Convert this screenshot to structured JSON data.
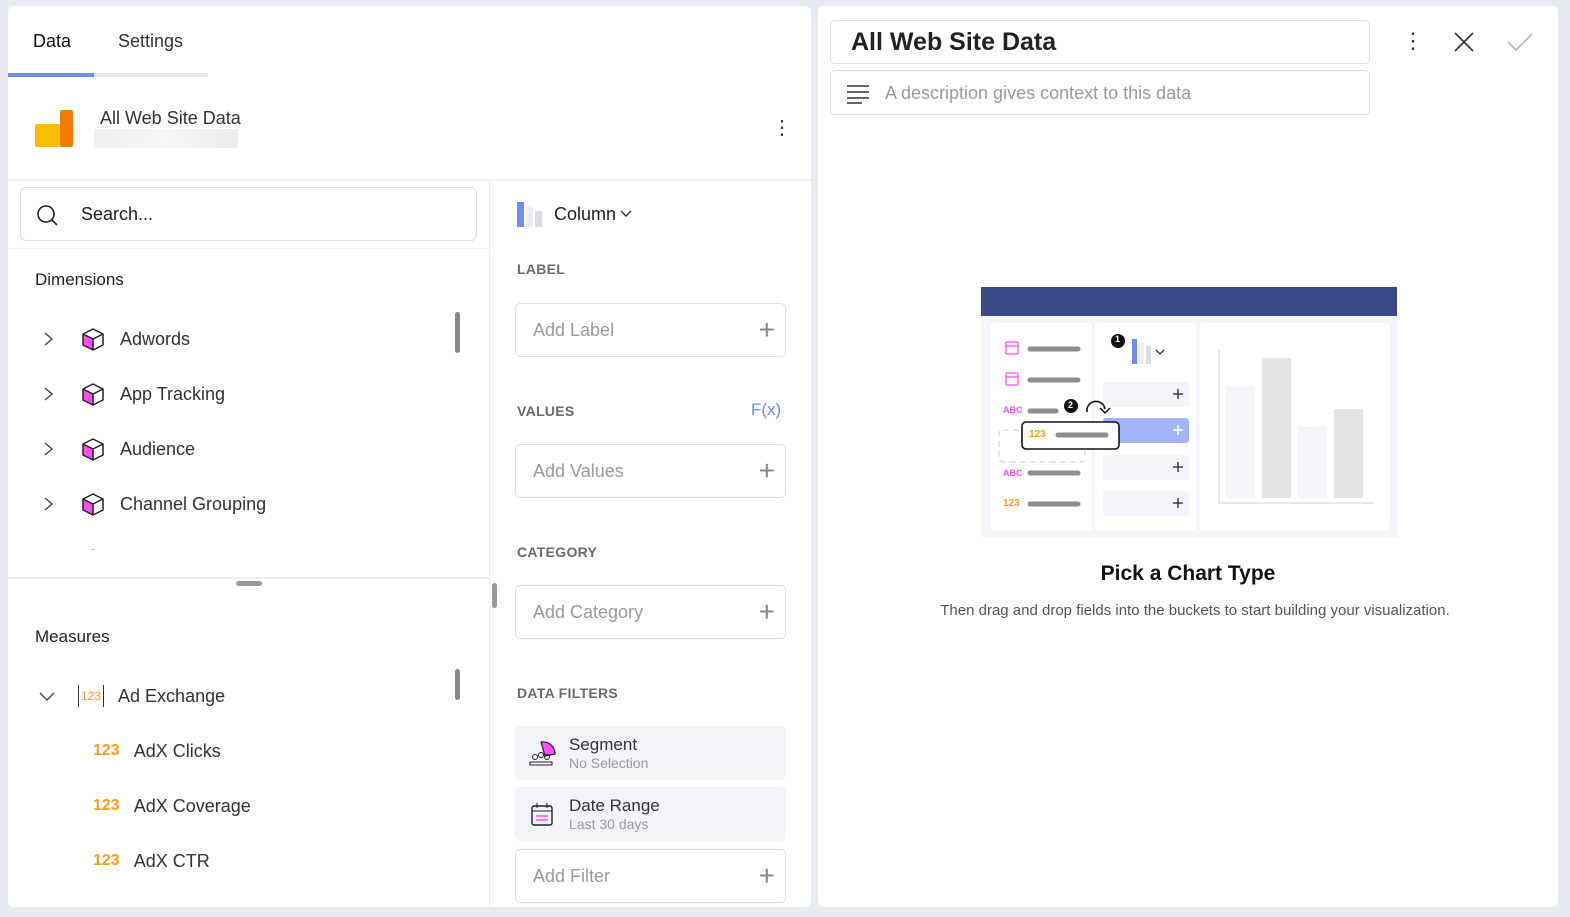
{
  "tabs": [
    {
      "label": "Data",
      "active": true
    },
    {
      "label": "Settings",
      "active": false
    }
  ],
  "source": {
    "title": "All Web Site Data"
  },
  "search": {
    "placeholder": "Search..."
  },
  "dimensions": {
    "title": "Dimensions",
    "items": [
      "Adwords",
      "App Tracking",
      "Audience",
      "Channel Grouping"
    ]
  },
  "measures": {
    "title": "Measures",
    "group": "Ad Exchange",
    "group_icon": "123",
    "items": [
      "AdX Clicks",
      "AdX Coverage",
      "AdX CTR"
    ]
  },
  "chart_type": {
    "label": "Column"
  },
  "buckets": {
    "label": {
      "caption": "LABEL",
      "placeholder": "Add Label"
    },
    "values": {
      "caption": "VALUES",
      "placeholder": "Add Values",
      "fx": "F(x)"
    },
    "category": {
      "caption": "CATEGORY",
      "placeholder": "Add Category"
    },
    "filters": {
      "caption": "DATA FILTERS",
      "segment": {
        "title": "Segment",
        "value": "No Selection"
      },
      "date_range": {
        "title": "Date Range",
        "value": "Last 30 days"
      },
      "add": "Add Filter"
    }
  },
  "editor": {
    "title": "All Web Site Data",
    "description_placeholder": "A description gives context to this data"
  },
  "empty_state": {
    "title": "Pick a Chart Type",
    "subtitle": "Then drag and drop fields into the buckets to start building your visualization.",
    "illus": {
      "abc": "ABC",
      "num": "123",
      "step1": "1",
      "step2": "2"
    }
  },
  "colors": {
    "accent": "#6e8cf3",
    "magenta": "#ff4cf5",
    "orange": "#f99d1c",
    "navy": "#3d4886"
  }
}
